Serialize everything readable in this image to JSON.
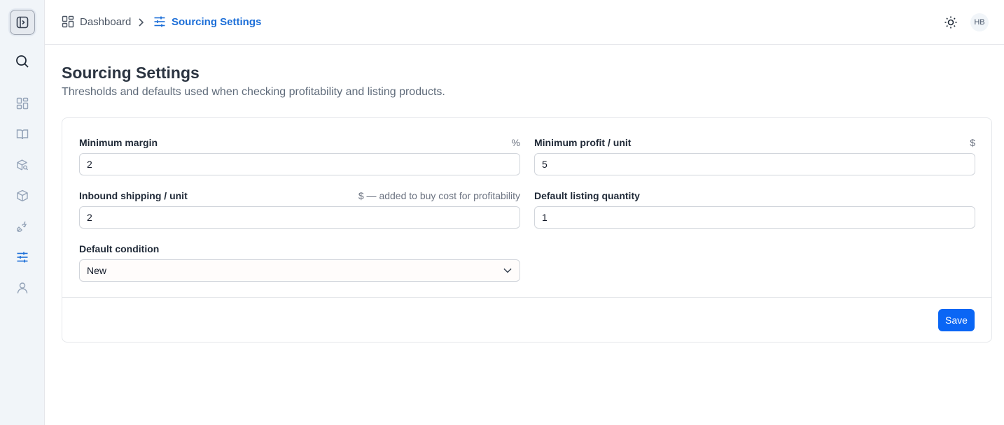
{
  "sidebar": {
    "items": [
      {
        "name": "dashboard",
        "icon": "grid-icon"
      },
      {
        "name": "catalog",
        "icon": "book-open-icon"
      },
      {
        "name": "product-search",
        "icon": "package-search-icon"
      },
      {
        "name": "products",
        "icon": "box-icon"
      },
      {
        "name": "integrations",
        "icon": "plug-icon"
      },
      {
        "name": "sourcing-settings",
        "icon": "sliders-icon"
      },
      {
        "name": "account",
        "icon": "user-icon"
      }
    ],
    "active": "sourcing-settings"
  },
  "header": {
    "breadcrumb": {
      "home": "Dashboard",
      "current": "Sourcing Settings"
    },
    "avatar_initials": "HB"
  },
  "page": {
    "title": "Sourcing Settings",
    "subtitle": "Thresholds and defaults used when checking profitability and listing products."
  },
  "form": {
    "min_margin": {
      "label": "Minimum margin",
      "hint": "%",
      "value": "2"
    },
    "min_profit": {
      "label": "Minimum profit / unit",
      "hint": "$",
      "value": "5"
    },
    "inbound_shipping": {
      "label": "Inbound shipping / unit",
      "hint": "$ — added to buy cost for profitability",
      "value": "2"
    },
    "listing_qty": {
      "label": "Default listing quantity",
      "hint": "",
      "value": "1"
    },
    "condition": {
      "label": "Default condition",
      "value": "New"
    },
    "save_label": "Save"
  },
  "colors": {
    "accent": "#0a66f5",
    "active_nav": "#1d6fd8"
  }
}
